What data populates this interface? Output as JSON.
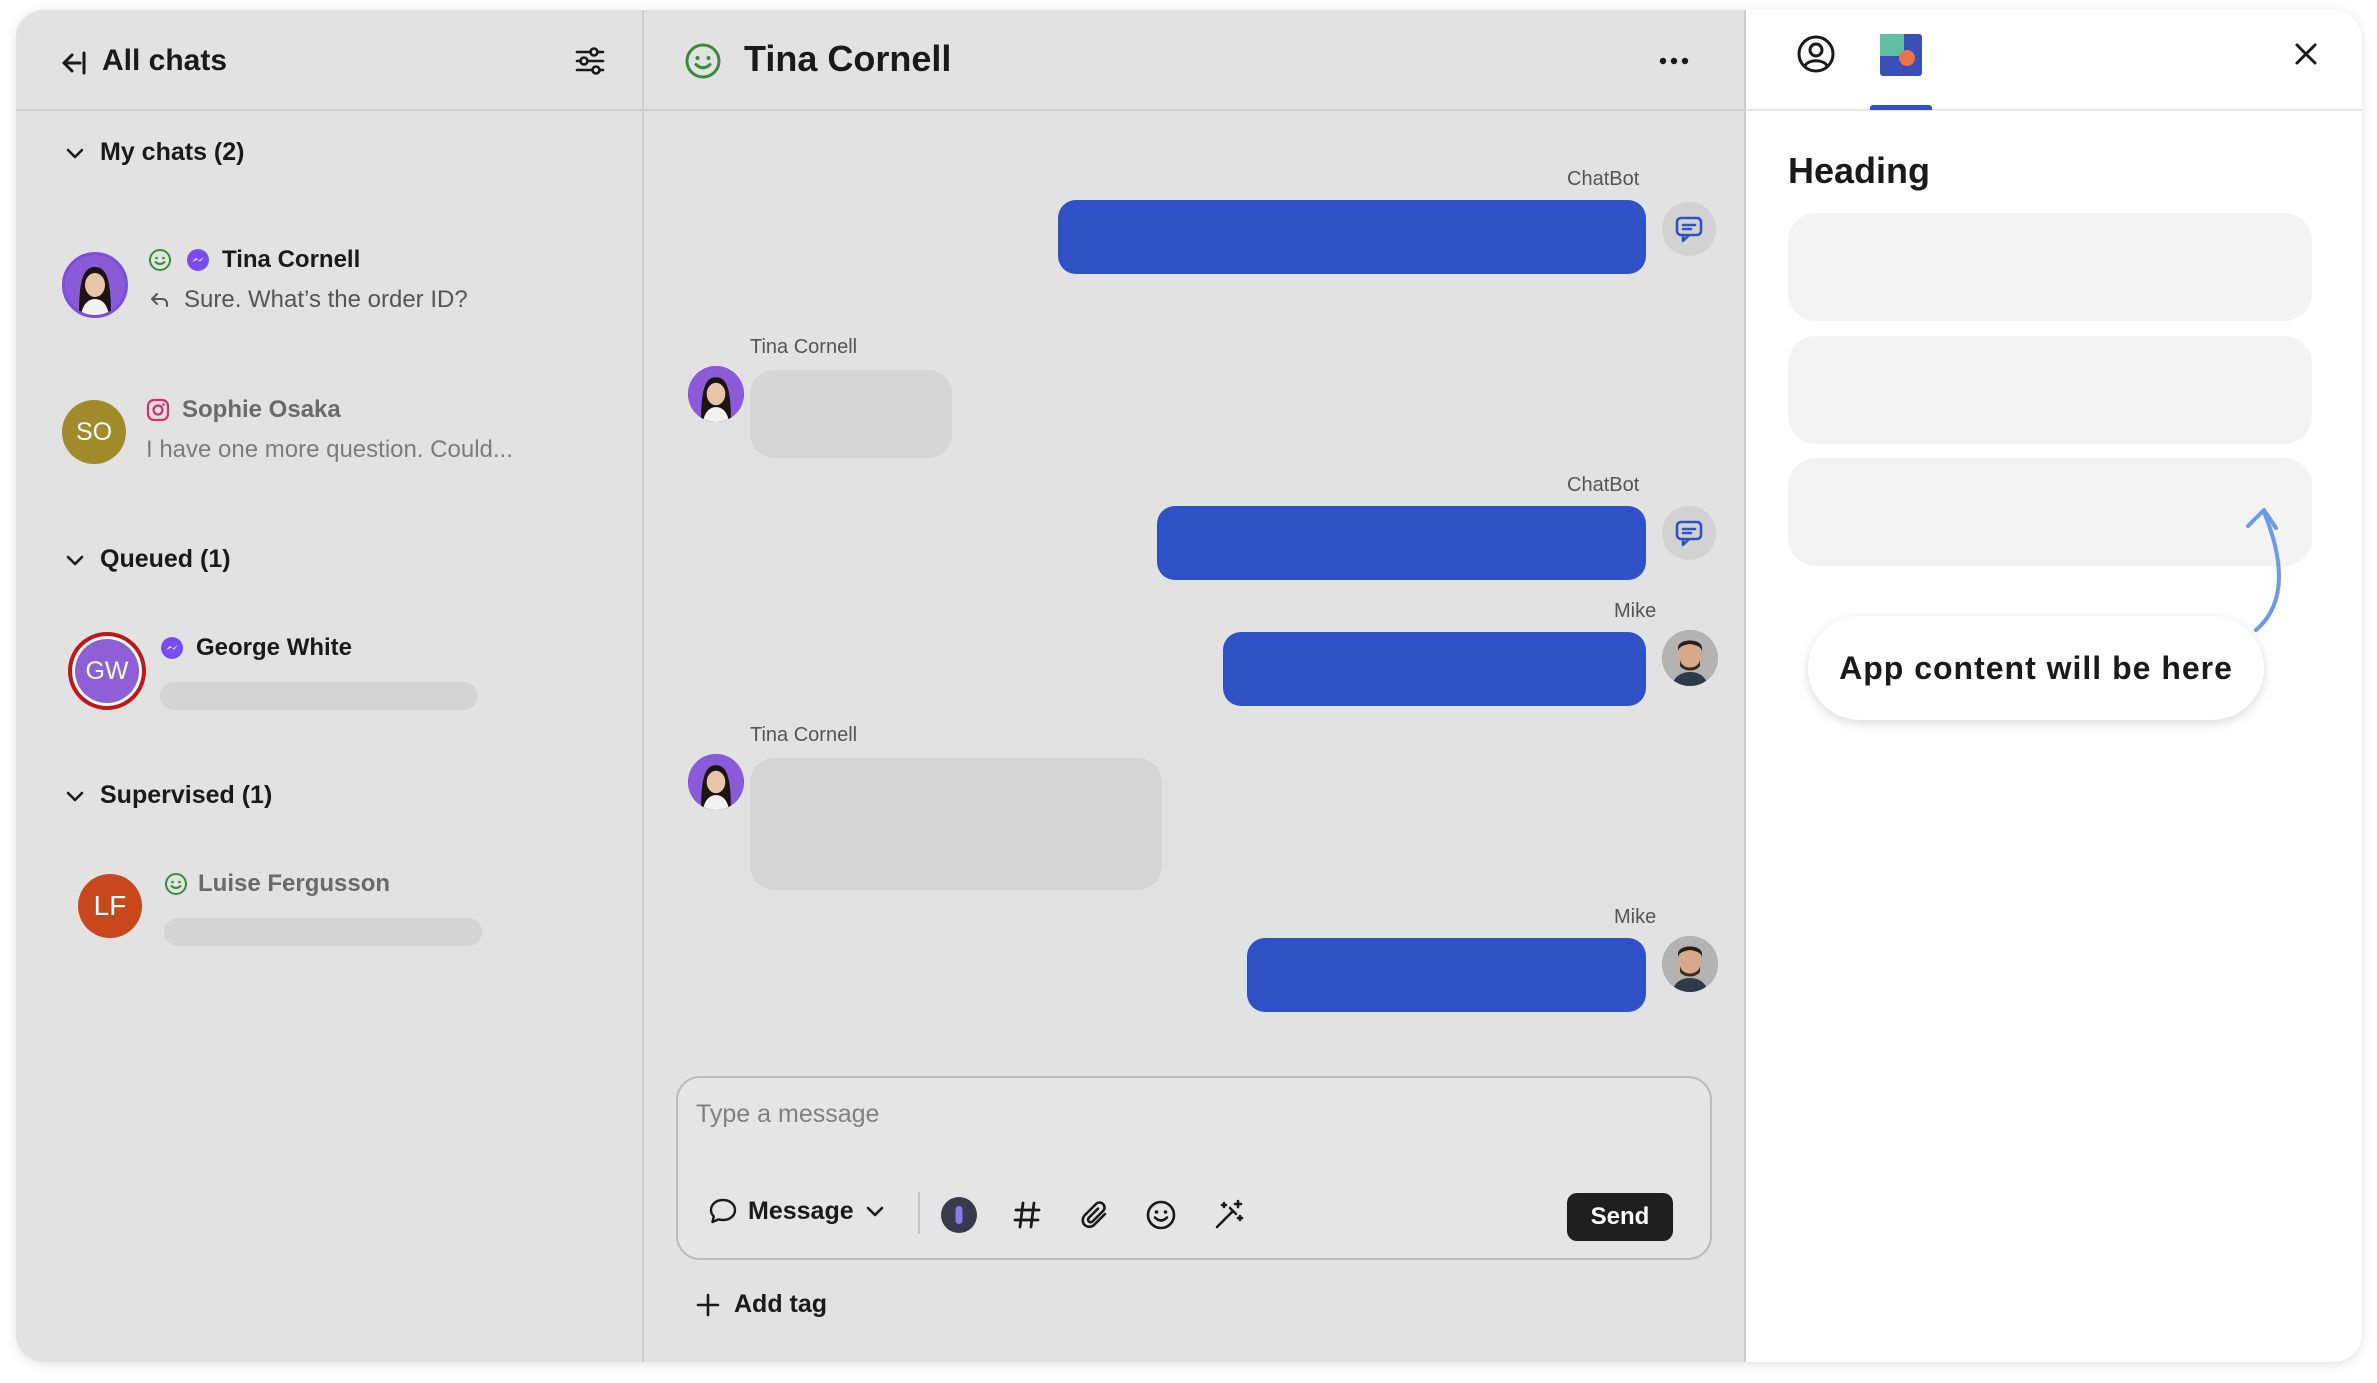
{
  "left": {
    "title": "All chats",
    "sections": {
      "my_chats": "My chats (2)",
      "queued": "Queued (1)",
      "supervised": "Supervised (1)"
    },
    "chats": [
      {
        "name": "Tina Cornell",
        "preview": "Sure. What’s the order ID?",
        "channel": "messenger-icon",
        "status": "smile-icon"
      },
      {
        "name": "Sophie Osaka",
        "initials": "SO",
        "preview": "I have one more question. Could...",
        "channel": "instagram-icon"
      },
      {
        "name": "George White",
        "initials": "GW",
        "channel": "messenger-icon"
      },
      {
        "name": "Luise  Fergusson",
        "initials": "LF",
        "status": "smile-icon"
      }
    ]
  },
  "center": {
    "title": "Tina Cornell",
    "messages": [
      {
        "author": "ChatBot",
        "direction": "out"
      },
      {
        "author": "Tina Cornell",
        "direction": "in"
      },
      {
        "author": "ChatBot",
        "direction": "out"
      },
      {
        "author": "Mike",
        "direction": "out"
      },
      {
        "author": "Tina Cornell",
        "direction": "in"
      },
      {
        "author": "Mike",
        "direction": "out"
      }
    ],
    "composer": {
      "placeholder": "Type a message",
      "message_type": "Message",
      "send": "Send"
    },
    "add_tag": "Add tag"
  },
  "right": {
    "heading": "Heading",
    "callout": "App content will be here"
  },
  "colors": {
    "accent": "#2f51c6",
    "panel_bg": "#e2e2e2",
    "status_green": "#3a8a3a",
    "sophie_avatar": "#a08a2a",
    "george_avatar": "#8f5fd6",
    "luise_avatar": "#c9471c"
  }
}
